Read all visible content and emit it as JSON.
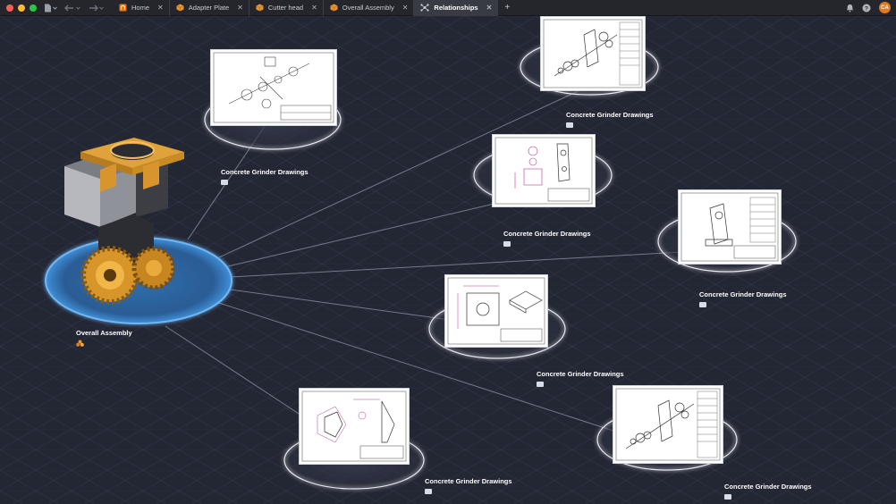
{
  "tabs": [
    {
      "label": "Home",
      "icon": "home-icon",
      "active": false
    },
    {
      "label": "Adapter Plate",
      "icon": "part-icon",
      "active": false
    },
    {
      "label": "Cutter head",
      "icon": "part-icon",
      "active": false
    },
    {
      "label": "Overall Assembly",
      "icon": "assembly-icon",
      "active": false
    },
    {
      "label": "Relationships",
      "icon": "relationships-icon",
      "active": true
    }
  ],
  "user_initials": "CA",
  "colors": {
    "accent": "#e0791f",
    "canvas": "#232633",
    "hub_glow": "#3f8fd8"
  },
  "hub": {
    "label": "Overall Assembly",
    "icon": "assembly-icon"
  },
  "drawings": [
    {
      "label": "Concrete Grinder Drawings",
      "icon": "drawing-icon"
    },
    {
      "label": "Concrete Grinder Drawings",
      "icon": "drawing-icon"
    },
    {
      "label": "Concrete Grinder Drawings",
      "icon": "drawing-icon"
    },
    {
      "label": "Concrete Grinder Drawings",
      "icon": "drawing-icon"
    },
    {
      "label": "Concrete Grinder Drawings",
      "icon": "drawing-icon"
    },
    {
      "label": "Concrete Grinder Drawings",
      "icon": "drawing-icon"
    },
    {
      "label": "Concrete Grinder Drawings",
      "icon": "drawing-icon"
    }
  ]
}
